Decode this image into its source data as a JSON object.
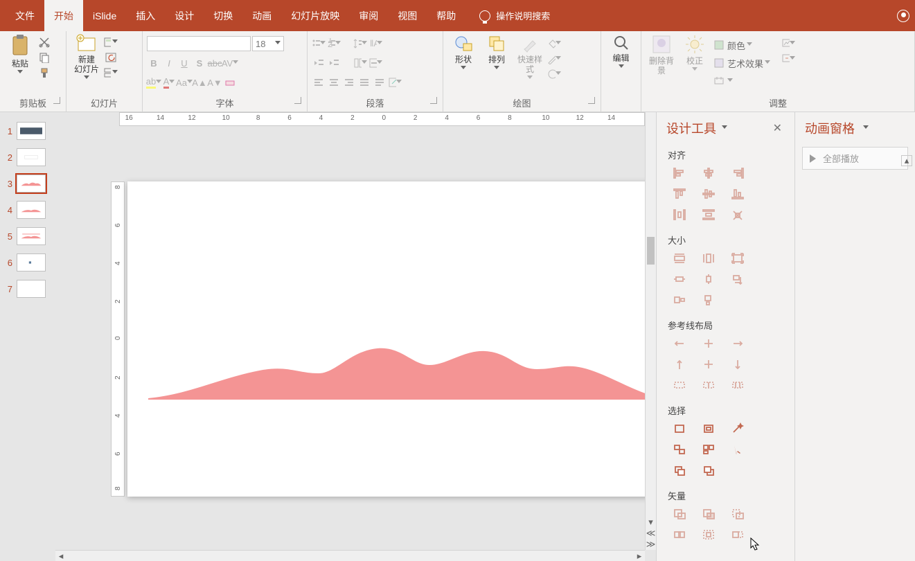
{
  "tabs": {
    "file": "文件",
    "home": "开始",
    "islide": "iSlide",
    "insert": "插入",
    "design": "设计",
    "transition": "切换",
    "animation": "动画",
    "slideshow": "幻灯片放映",
    "review": "审阅",
    "view": "视图",
    "help": "帮助",
    "tellme": "操作说明搜索"
  },
  "ribbon": {
    "clipboard": {
      "paste": "粘贴",
      "group": "剪贴板"
    },
    "slides": {
      "new_slide": "新建\n幻灯片",
      "group": "幻灯片"
    },
    "font": {
      "size": "18",
      "group": "字体"
    },
    "paragraph": {
      "group": "段落"
    },
    "drawing": {
      "shapes": "形状",
      "arrange": "排列",
      "quickstyle": "快速样式",
      "group": "绘图"
    },
    "editing": {
      "find": "编辑"
    },
    "adjust": {
      "removebg": "删除背景",
      "correction": "校正",
      "color": "颜色",
      "artfx": "艺术效果",
      "group": "调整"
    }
  },
  "thumbs": {
    "numbers": [
      "1",
      "2",
      "3",
      "4",
      "5",
      "6",
      "7"
    ],
    "selected_index": 2
  },
  "ruler": {
    "h": [
      "16",
      "14",
      "12",
      "10",
      "8",
      "6",
      "4",
      "2",
      "0",
      "2",
      "4",
      "6",
      "8",
      "10",
      "12",
      "14"
    ],
    "v": [
      "8",
      "6",
      "4",
      "2",
      "0",
      "2",
      "4",
      "6",
      "8"
    ]
  },
  "designPane": {
    "title": "设计工具",
    "sections": {
      "align": "对齐",
      "size": "大小",
      "guides": "参考线布局",
      "select": "选择",
      "vector": "矢量"
    }
  },
  "animPane": {
    "title": "动画窗格",
    "play_all": "全部播放"
  },
  "colors": {
    "accent": "#b7472a",
    "mountain": "#f49494"
  }
}
